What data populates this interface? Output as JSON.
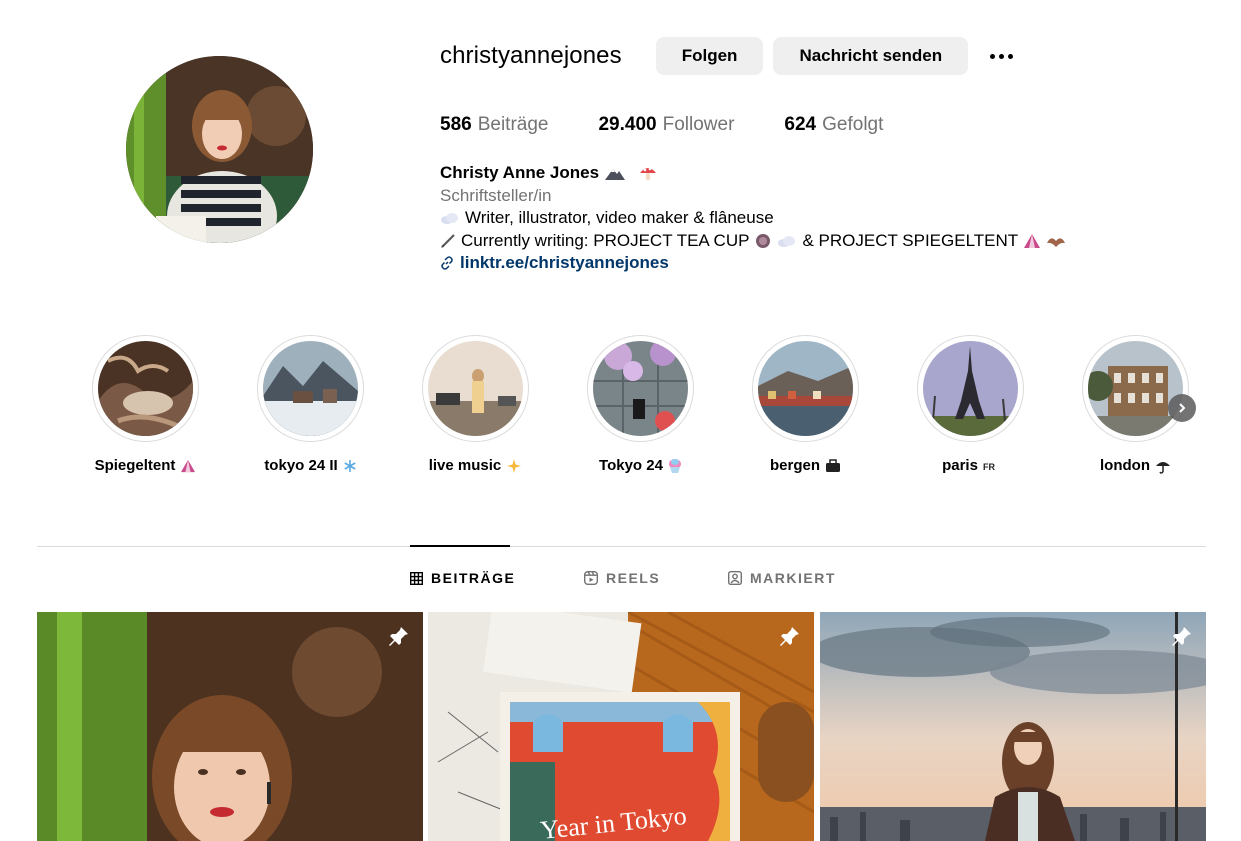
{
  "profile": {
    "username": "christyannejones",
    "follow_label": "Folgen",
    "message_label": "Nachricht senden",
    "more_icon": "more-dots-icon"
  },
  "stats": {
    "posts_count": "586",
    "posts_label": "Beiträge",
    "followers_count": "29.400",
    "followers_label": "Follower",
    "following_count": "624",
    "following_label": "Gefolgt"
  },
  "bio": {
    "name": "Christy Anne Jones",
    "category": "Schriftsteller/in",
    "line1": "Writer, illustrator, video maker & flâneuse",
    "line2_a": "Currently writing: PROJECT TEA CUP",
    "line2_b": "& PROJECT SPIEGELTENT",
    "link": "linktr.ee/christyannejones"
  },
  "highlights": [
    {
      "label": "Spiegeltent",
      "emoji": "circus-tent-icon"
    },
    {
      "label": "tokyo 24 II",
      "emoji": "snowflake-icon"
    },
    {
      "label": "live music",
      "emoji": "sparkles-icon"
    },
    {
      "label": "Tokyo 24",
      "emoji": "shaved-ice-icon"
    },
    {
      "label": "bergen",
      "emoji": "briefcase-icon"
    },
    {
      "label": "paris",
      "emoji": "fr-flag-icon"
    },
    {
      "label": "london",
      "emoji": "umbrella-rain-icon"
    }
  ],
  "tabs": [
    {
      "label": "BEITRÄGE",
      "icon": "grid-icon",
      "active": true
    },
    {
      "label": "REELS",
      "icon": "reels-icon",
      "active": false
    },
    {
      "label": "MARKIERT",
      "icon": "tagged-icon",
      "active": false
    }
  ],
  "posts": [
    {
      "pinned": true,
      "overlay_text": ""
    },
    {
      "pinned": true,
      "overlay_text": "Year in Tokyo"
    },
    {
      "pinned": true,
      "overlay_text": ""
    }
  ],
  "colors": {
    "link": "#00376b",
    "muted": "#737373",
    "button_bg": "#efefef",
    "divider": "#dbdbdb"
  }
}
